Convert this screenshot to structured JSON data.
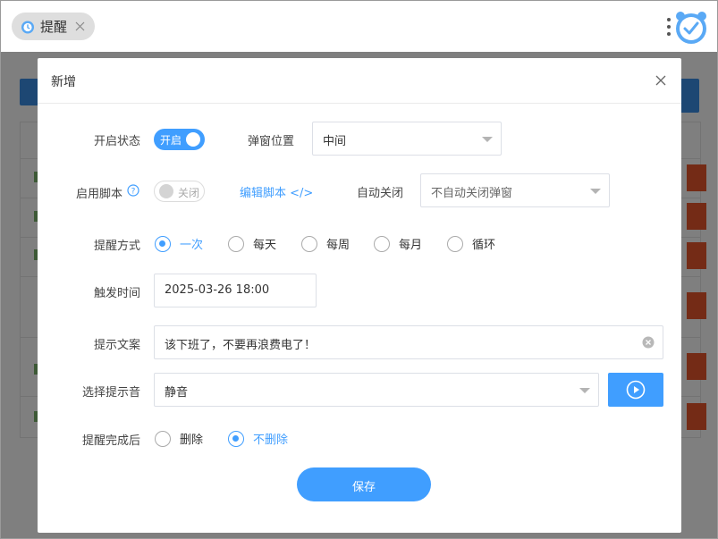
{
  "window": {
    "tab_title": "提醒",
    "accent": "#409eff"
  },
  "dialog": {
    "title": "新增",
    "enable_status": {
      "label": "开启状态",
      "toggle_text": "开启",
      "on": true
    },
    "popup_position": {
      "label": "弹窗位置",
      "value": "中间"
    },
    "enable_script": {
      "label": "启用脚本",
      "toggle_text": "关闭",
      "on": false
    },
    "edit_script_link": "编辑脚本 </>",
    "auto_close": {
      "label": "自动关闭",
      "value": "不自动关闭弹窗"
    },
    "remind_mode": {
      "label": "提醒方式",
      "options": [
        "一次",
        "每天",
        "每周",
        "每月",
        "循环"
      ],
      "selected": "一次"
    },
    "trigger_time": {
      "label": "触发时间",
      "value": "2025-03-26 18:00"
    },
    "prompt_text": {
      "label": "提示文案",
      "value": "该下班了，不要再浪费电了！"
    },
    "sound": {
      "label": "选择提示音",
      "value": "静音"
    },
    "after_done": {
      "label": "提醒完成后",
      "options": [
        "删除",
        "不删除"
      ],
      "selected": "不删除"
    },
    "save_label": "保存"
  }
}
